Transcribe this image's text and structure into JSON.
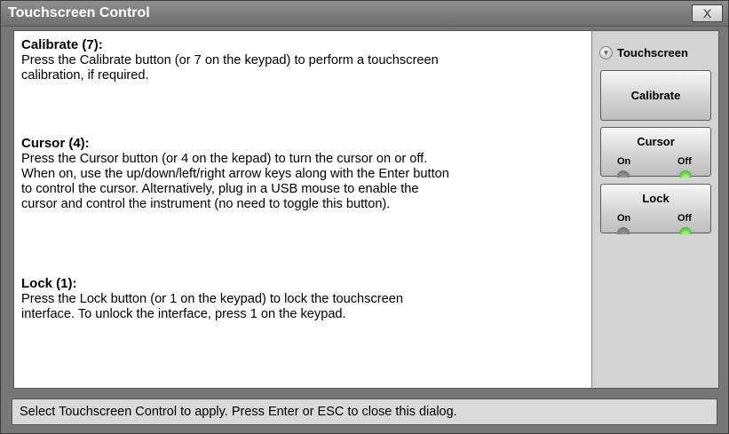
{
  "window": {
    "title": "Touchscreen Control",
    "close_label": "X"
  },
  "help": {
    "calibrate": {
      "heading": "Calibrate (7):",
      "body": "Press the Calibrate button (or 7 on the keypad) to perform a touchscreen\ncalibration, if required."
    },
    "cursor": {
      "heading": "Cursor (4):",
      "body": "Press the Cursor button (or 4 on the kepad) to turn the cursor on or off.\nWhen on, use the up/down/left/right arrow keys along with the Enter button\nto control the cursor.  Alternatively, plug in a USB mouse to enable the\ncursor and control the instrument (no need to toggle this button)."
    },
    "lock": {
      "heading": "Lock (1):",
      "body": "Press the Lock button (or 1 on the keypad) to lock the touchscreen\ninterface. To unlock the interface, press 1 on the keypad."
    }
  },
  "side_panel": {
    "touchscreen_label": "Touchscreen",
    "calibrate_label": "Calibrate",
    "cursor": {
      "label": "Cursor",
      "on_label": "On",
      "off_label": "Off",
      "state": "Off"
    },
    "lock": {
      "label": "Lock",
      "on_label": "On",
      "off_label": "Off",
      "state": "Off"
    }
  },
  "status_bar": {
    "text": "Select Touchscreen Control to apply.  Press Enter or ESC to close this dialog."
  },
  "colors": {
    "titlebar": "#7a7a7a",
    "panel": "#d2d2d2",
    "led_active": "#2ecc2e",
    "led_inactive": "#7a7a7a"
  }
}
